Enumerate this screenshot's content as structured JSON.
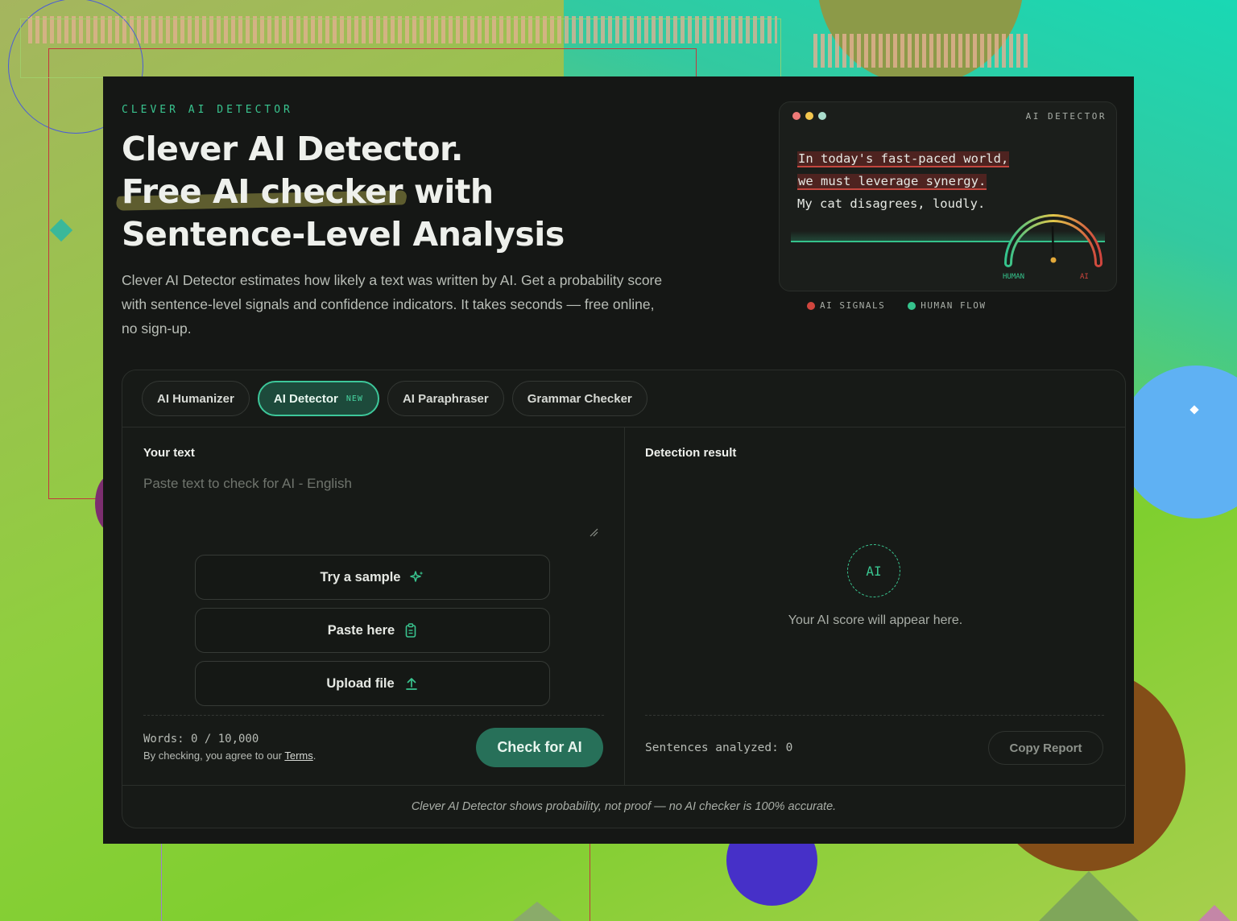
{
  "hero": {
    "eyebrow": "CLEVER AI DETECTOR",
    "headline_line1": "Clever AI Detector.",
    "headline_line2_highlight": "Free AI checker",
    "headline_line2_rest": " with",
    "headline_line3": "Sentence-Level Analysis",
    "subtitle": "Clever AI Detector estimates how likely a text was written by AI. Get a probability score with sentence-level signals and confidence indicators. It takes seconds — free online, no sign-up."
  },
  "preview": {
    "label": "AI DETECTOR",
    "lines": [
      "In today's fast-paced world,",
      "we must leverage synergy.",
      "My cat disagrees, loudly."
    ],
    "gauge": {
      "min_label": "HUMAN",
      "max_label": "AI"
    },
    "legend": [
      {
        "label": "AI SIGNALS",
        "color": "#d0463e"
      },
      {
        "label": "HUMAN FLOW",
        "color": "#35c38c"
      }
    ]
  },
  "tabs": [
    {
      "label": "AI Humanizer",
      "active": false,
      "badge": ""
    },
    {
      "label": "AI Detector",
      "active": true,
      "badge": "NEW"
    },
    {
      "label": "AI Paraphraser",
      "active": false,
      "badge": ""
    },
    {
      "label": "Grammar Checker",
      "active": false,
      "badge": ""
    }
  ],
  "input": {
    "title": "Your text",
    "placeholder": "Paste text to check for AI - English",
    "actions": {
      "sample": "Try a sample",
      "paste": "Paste here",
      "upload": "Upload file"
    },
    "words": "Words: 0 / 10,000",
    "agree_prefix": "By checking, you agree to our ",
    "agree_link": "Terms",
    "agree_suffix": ".",
    "check_button": "Check for AI"
  },
  "result": {
    "title": "Detection result",
    "badge": "AI",
    "placeholder": "Your AI score will appear here.",
    "sentences": "Sentences analyzed: 0",
    "copy_button": "Copy Report"
  },
  "footer": {
    "disclaimer": "Clever AI Detector shows probability, not proof — no AI checker is 100% accurate."
  },
  "colors": {
    "accent": "#39c48f",
    "accent_button": "#277059",
    "ai_signal": "#d0463e",
    "human_flow": "#35c38c",
    "panel_bg": "#151715"
  }
}
